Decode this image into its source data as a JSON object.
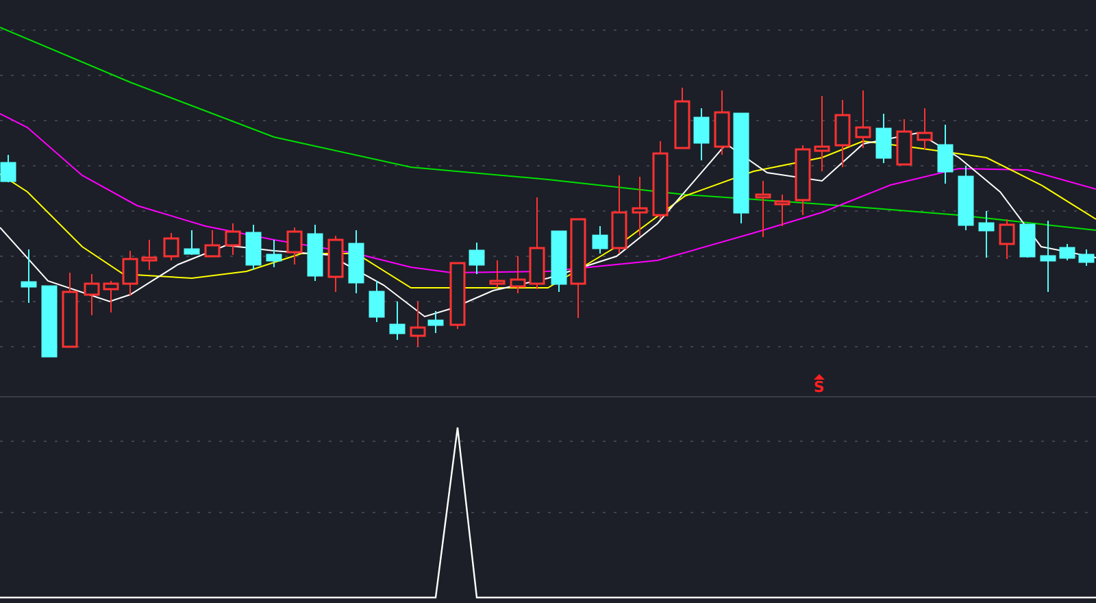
{
  "signal_marker": {
    "label": "S"
  }
}
